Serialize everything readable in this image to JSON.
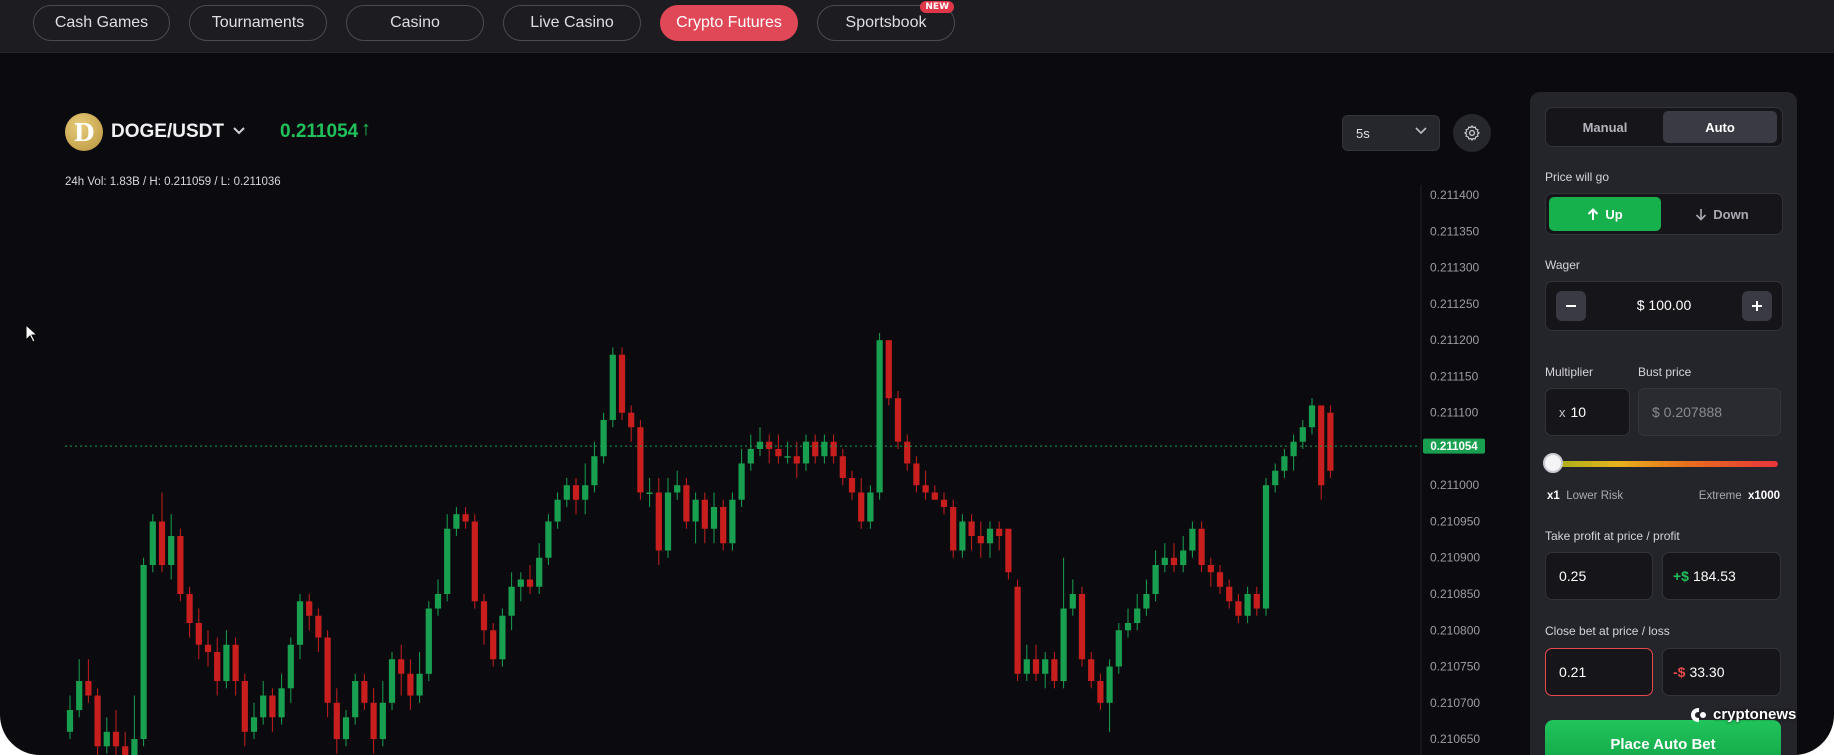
{
  "nav": {
    "items": [
      {
        "label": "Cash Games"
      },
      {
        "label": "Tournaments"
      },
      {
        "label": "Casino"
      },
      {
        "label": "Live Casino"
      },
      {
        "label": "Crypto Futures",
        "active": true
      },
      {
        "label": "Sportsbook",
        "badge": "NEW"
      }
    ]
  },
  "pair": {
    "logo_letter": "D",
    "name": "DOGE/USDT",
    "price": "0.211054",
    "price_arrow": "↑",
    "stats": "24h Vol: 1.83B / H: 0.211059 / L: 0.211036"
  },
  "controls": {
    "interval": "5s"
  },
  "chart_data": {
    "type": "candlestick",
    "y_ticks": [
      "0.211400",
      "0.211350",
      "0.211300",
      "0.211250",
      "0.211200",
      "0.211150",
      "0.211100",
      "0.211050",
      "0.211000",
      "0.210950",
      "0.210900",
      "0.210850",
      "0.210800",
      "0.210750",
      "0.210700",
      "0.210650"
    ],
    "ylim": [
      0.210628,
      0.211414
    ],
    "current_price_label": "0.211054",
    "current_price": 0.211054,
    "colors": {
      "up": "#18a050",
      "down": "#c81e1e"
    },
    "candles": [
      [
        0.21066,
        0.21069,
        0.21071,
        0.21065
      ],
      [
        0.21069,
        0.21073,
        0.21076,
        0.21068
      ],
      [
        0.21073,
        0.21071,
        0.21076,
        0.2107
      ],
      [
        0.21071,
        0.21064,
        0.21072,
        0.21062
      ],
      [
        0.21064,
        0.21066,
        0.21068,
        0.21063
      ],
      [
        0.21066,
        0.21064,
        0.21069,
        0.21062
      ],
      [
        0.21064,
        0.21062,
        0.21066,
        0.2106
      ],
      [
        0.21062,
        0.21065,
        0.21071,
        0.21061
      ],
      [
        0.21065,
        0.21089,
        0.2109,
        0.21064
      ],
      [
        0.21089,
        0.21095,
        0.21096,
        0.21088
      ],
      [
        0.21095,
        0.21089,
        0.21099,
        0.21088
      ],
      [
        0.21089,
        0.21093,
        0.21096,
        0.21087
      ],
      [
        0.21093,
        0.21085,
        0.21094,
        0.21084
      ],
      [
        0.21085,
        0.21081,
        0.21086,
        0.21079
      ],
      [
        0.21081,
        0.21078,
        0.21083,
        0.21076
      ],
      [
        0.21078,
        0.21077,
        0.2108,
        0.21075
      ],
      [
        0.21077,
        0.21073,
        0.21079,
        0.21071
      ],
      [
        0.21073,
        0.21078,
        0.2108,
        0.21072
      ],
      [
        0.21078,
        0.21073,
        0.21079,
        0.21071
      ],
      [
        0.21073,
        0.21066,
        0.21074,
        0.21064
      ],
      [
        0.21066,
        0.21068,
        0.2107,
        0.21065
      ],
      [
        0.21068,
        0.21071,
        0.21073,
        0.21067
      ],
      [
        0.21071,
        0.21068,
        0.21072,
        0.21066
      ],
      [
        0.21068,
        0.21072,
        0.21074,
        0.21067
      ],
      [
        0.21072,
        0.21078,
        0.21079,
        0.2107
      ],
      [
        0.21078,
        0.21084,
        0.21085,
        0.21076
      ],
      [
        0.21084,
        0.21082,
        0.21085,
        0.2108
      ],
      [
        0.21082,
        0.21079,
        0.21083,
        0.21077
      ],
      [
        0.21079,
        0.2107,
        0.2108,
        0.21068
      ],
      [
        0.2107,
        0.21065,
        0.21072,
        0.21063
      ],
      [
        0.21065,
        0.21068,
        0.21069,
        0.21064
      ],
      [
        0.21068,
        0.21073,
        0.21074,
        0.21067
      ],
      [
        0.21073,
        0.2107,
        0.21074,
        0.21069
      ],
      [
        0.2107,
        0.21065,
        0.21072,
        0.21063
      ],
      [
        0.21065,
        0.2107,
        0.21073,
        0.21064
      ],
      [
        0.2107,
        0.21076,
        0.21077,
        0.21069
      ],
      [
        0.21076,
        0.21074,
        0.21078,
        0.21071
      ],
      [
        0.21074,
        0.21071,
        0.21076,
        0.21069
      ],
      [
        0.21071,
        0.21074,
        0.21077,
        0.2107
      ],
      [
        0.21074,
        0.21083,
        0.21084,
        0.21073
      ],
      [
        0.21083,
        0.21085,
        0.21087,
        0.21082
      ],
      [
        0.21085,
        0.21094,
        0.21096,
        0.21084
      ],
      [
        0.21094,
        0.21096,
        0.21097,
        0.21093
      ],
      [
        0.21096,
        0.21095,
        0.21097,
        0.21094
      ],
      [
        0.21095,
        0.21084,
        0.21096,
        0.21083
      ],
      [
        0.21084,
        0.2108,
        0.21085,
        0.21078
      ],
      [
        0.2108,
        0.21076,
        0.21081,
        0.21075
      ],
      [
        0.21076,
        0.21082,
        0.21083,
        0.21075
      ],
      [
        0.21082,
        0.21086,
        0.21088,
        0.2108
      ],
      [
        0.21086,
        0.21087,
        0.21088,
        0.21084
      ],
      [
        0.21087,
        0.21086,
        0.21089,
        0.21085
      ],
      [
        0.21086,
        0.2109,
        0.21092,
        0.21085
      ],
      [
        0.2109,
        0.21095,
        0.21096,
        0.21089
      ],
      [
        0.21095,
        0.21098,
        0.21099,
        0.21094
      ],
      [
        0.21098,
        0.211,
        0.21101,
        0.21097
      ],
      [
        0.211,
        0.21098,
        0.21101,
        0.21096
      ],
      [
        0.21098,
        0.211,
        0.21103,
        0.21096
      ],
      [
        0.211,
        0.21104,
        0.21106,
        0.21099
      ],
      [
        0.21104,
        0.21109,
        0.2111,
        0.21103
      ],
      [
        0.21109,
        0.21118,
        0.21119,
        0.21108
      ],
      [
        0.21118,
        0.2111,
        0.21119,
        0.21109
      ],
      [
        0.2111,
        0.21108,
        0.21111,
        0.21106
      ],
      [
        0.21108,
        0.21099,
        0.21109,
        0.21098
      ],
      [
        0.21099,
        0.21099,
        0.21101,
        0.21097
      ],
      [
        0.21099,
        0.21091,
        0.21101,
        0.21089
      ],
      [
        0.21091,
        0.21099,
        0.21101,
        0.2109
      ],
      [
        0.21099,
        0.211,
        0.21102,
        0.21098
      ],
      [
        0.211,
        0.21095,
        0.21101,
        0.21094
      ],
      [
        0.21095,
        0.21098,
        0.21099,
        0.21092
      ],
      [
        0.21098,
        0.21094,
        0.21099,
        0.21092
      ],
      [
        0.21094,
        0.21097,
        0.21099,
        0.21092
      ],
      [
        0.21097,
        0.21092,
        0.21098,
        0.21091
      ],
      [
        0.21092,
        0.21098,
        0.21099,
        0.21091
      ],
      [
        0.21098,
        0.21103,
        0.21105,
        0.21097
      ],
      [
        0.21103,
        0.21105,
        0.21107,
        0.21102
      ],
      [
        0.21105,
        0.21106,
        0.21108,
        0.21104
      ],
      [
        0.21106,
        0.21105,
        0.21107,
        0.21103
      ],
      [
        0.21105,
        0.21104,
        0.21107,
        0.21103
      ],
      [
        0.21104,
        0.21104,
        0.21106,
        0.21103
      ],
      [
        0.21104,
        0.21103,
        0.21106,
        0.21101
      ],
      [
        0.21103,
        0.21106,
        0.21107,
        0.21102
      ],
      [
        0.21106,
        0.21104,
        0.21107,
        0.21103
      ],
      [
        0.21104,
        0.21106,
        0.21107,
        0.21103
      ],
      [
        0.21106,
        0.21104,
        0.21107,
        0.21103
      ],
      [
        0.21104,
        0.21101,
        0.21105,
        0.211
      ],
      [
        0.21101,
        0.21099,
        0.21102,
        0.21098
      ],
      [
        0.21099,
        0.21095,
        0.21101,
        0.21094
      ],
      [
        0.21095,
        0.21099,
        0.211,
        0.21094
      ],
      [
        0.21099,
        0.2112,
        0.21121,
        0.21098
      ],
      [
        0.2112,
        0.21112,
        0.2112,
        0.21111
      ],
      [
        0.21112,
        0.21106,
        0.21113,
        0.21105
      ],
      [
        0.21106,
        0.21103,
        0.21107,
        0.21102
      ],
      [
        0.21103,
        0.211,
        0.21104,
        0.21099
      ],
      [
        0.211,
        0.21099,
        0.21102,
        0.21098
      ],
      [
        0.21099,
        0.21098,
        0.211,
        0.21098
      ],
      [
        0.21098,
        0.21097,
        0.21099,
        0.21096
      ],
      [
        0.21097,
        0.21091,
        0.21098,
        0.2109
      ],
      [
        0.21091,
        0.21095,
        0.21096,
        0.2109
      ],
      [
        0.21095,
        0.21093,
        0.21096,
        0.21091
      ],
      [
        0.21093,
        0.21092,
        0.21095,
        0.2109
      ],
      [
        0.21092,
        0.21094,
        0.21095,
        0.2109
      ],
      [
        0.21094,
        0.21093,
        0.21095,
        0.21091
      ],
      [
        0.21094,
        0.21088,
        0.21094,
        0.21087
      ],
      [
        0.21086,
        0.21074,
        0.21087,
        0.21073
      ],
      [
        0.21074,
        0.21076,
        0.21078,
        0.21073
      ],
      [
        0.21076,
        0.21074,
        0.21078,
        0.21073
      ],
      [
        0.21074,
        0.21076,
        0.21077,
        0.21072
      ],
      [
        0.21076,
        0.21073,
        0.21077,
        0.21072
      ],
      [
        0.21073,
        0.21083,
        0.2109,
        0.21072
      ],
      [
        0.21083,
        0.21085,
        0.21087,
        0.21082
      ],
      [
        0.21085,
        0.21076,
        0.21086,
        0.21075
      ],
      [
        0.21076,
        0.21073,
        0.21077,
        0.21072
      ],
      [
        0.21073,
        0.2107,
        0.21074,
        0.21069
      ],
      [
        0.2107,
        0.21075,
        0.21076,
        0.21066
      ],
      [
        0.21075,
        0.2108,
        0.21081,
        0.21074
      ],
      [
        0.2108,
        0.21081,
        0.21083,
        0.21079
      ],
      [
        0.21081,
        0.21083,
        0.21085,
        0.2108
      ],
      [
        0.21083,
        0.21085,
        0.21087,
        0.21082
      ],
      [
        0.21085,
        0.21089,
        0.21091,
        0.21084
      ],
      [
        0.21089,
        0.2109,
        0.21092,
        0.21088
      ],
      [
        0.2109,
        0.21089,
        0.21092,
        0.21088
      ],
      [
        0.21089,
        0.21091,
        0.21093,
        0.21088
      ],
      [
        0.21091,
        0.21094,
        0.21095,
        0.2109
      ],
      [
        0.21094,
        0.21089,
        0.21095,
        0.21088
      ],
      [
        0.21089,
        0.21088,
        0.2109,
        0.21086
      ],
      [
        0.21088,
        0.21086,
        0.21089,
        0.21085
      ],
      [
        0.21086,
        0.21084,
        0.21087,
        0.21083
      ],
      [
        0.21084,
        0.21082,
        0.21085,
        0.21081
      ],
      [
        0.21082,
        0.21085,
        0.21086,
        0.21081
      ],
      [
        0.21085,
        0.21083,
        0.21086,
        0.21082
      ],
      [
        0.21083,
        0.211,
        0.21101,
        0.21082
      ],
      [
        0.211,
        0.21102,
        0.21103,
        0.21099
      ],
      [
        0.21102,
        0.21104,
        0.21105,
        0.21101
      ],
      [
        0.21104,
        0.21106,
        0.21107,
        0.21102
      ],
      [
        0.21106,
        0.21108,
        0.21109,
        0.21105
      ],
      [
        0.21108,
        0.21111,
        0.21112,
        0.21107
      ],
      [
        0.21111,
        0.211,
        0.21111,
        0.21098
      ],
      [
        0.2111,
        0.21102,
        0.21111,
        0.21101
      ]
    ]
  },
  "panel": {
    "mode_manual": "Manual",
    "mode_auto": "Auto",
    "direction_label": "Price will go",
    "up_label": "Up",
    "down_label": "Down",
    "wager_label": "Wager",
    "wager_value": "$ 100.00",
    "multiplier_label": "Multiplier",
    "multiplier_prefix": "x",
    "multiplier_value": "10",
    "bust_label": "Bust price",
    "bust_value": "$ 0.207888",
    "risk_min": "x1",
    "risk_min_label": "Lower Risk",
    "risk_max_label": "Extreme",
    "risk_max": "x1000",
    "risk_level": 0,
    "take_profit_label": "Take profit at price / profit",
    "take_profit_price": "0.25",
    "take_profit_prefix": "+$",
    "take_profit_amount": "184.53",
    "close_loss_label": "Close bet at price / loss",
    "close_loss_price": "0.21",
    "close_loss_prefix": "-$",
    "close_loss_amount": "33.30",
    "place_button": "Place Auto Bet"
  },
  "watermark": "cryptonews",
  "colors": {
    "accent_red": "#e04858",
    "up_green": "#20c05a",
    "button_green": "#16b04c",
    "loss_red": "#e84a4a"
  }
}
